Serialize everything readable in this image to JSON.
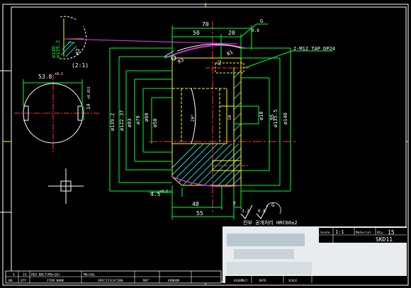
{
  "dims": {
    "d70": "70",
    "d50": "50",
    "d20": "20",
    "d48": "48",
    "d55": "55",
    "d7": "7",
    "d45": "4.5",
    "d45sup": "+0.2",
    "d45sub": "0",
    "w538": "53.8",
    "w538tol": "+0.2",
    "d14": "14",
    "d14tol": "+0.021",
    "dia140L": "ø140",
    "dia139L": "ø139.2",
    "dia139": "ø139.2",
    "dia139tol": "+0.1",
    "dia122": "ø122.37",
    "dia93": "ø93",
    "dia93tol": "±0.1",
    "dia79": "ø79",
    "dia79tol": "±1",
    "dia60": "ø60",
    "dia50": "ø50",
    "dia50tol": "+0.039",
    "dia18": "ø18",
    "dia95": "95",
    "dia135": "ø135.5",
    "dia140": "ø140",
    "r20": "20°",
    "r10": "10",
    "r1": "R1",
    "r2": "R2",
    "r3": "R3",
    "tap": "2-M12 TAP DP24",
    "scale": "(2:1)"
  },
  "notes": {
    "hrc_label": "전부 공개처리 HRC60±2",
    "finish_a": "3.2",
    "finish_b": "0.8",
    "finish_c": "G",
    "gdt_g": "G",
    "gdt_08": "0.8"
  },
  "title_block": {
    "scale_label": "Scale",
    "scale_value": "1:1",
    "mat_label": "Material",
    "qty_label": "Qty",
    "qty_value": "15",
    "material": "SKD11"
  },
  "bom": {
    "row": [
      "1",
      "15",
      "HEX BOLT(M6×16)",
      "",
      "M6×16L",
      "",
      ""
    ],
    "headers": [
      "NO.",
      "QTY",
      "ITEM NAME",
      "SPECIFICATION",
      "MAT'",
      "VENDOR"
    ],
    "right_items": [
      "ASSEMBLY",
      "DATE",
      "SCALE"
    ]
  },
  "colors": {
    "background": "#000000",
    "frame": "#ffffff",
    "part": "#ffff00",
    "dimension": "#00ff33",
    "center": "#ff3333",
    "highlight": "#cc33cc",
    "hatch": "#33ffff"
  }
}
